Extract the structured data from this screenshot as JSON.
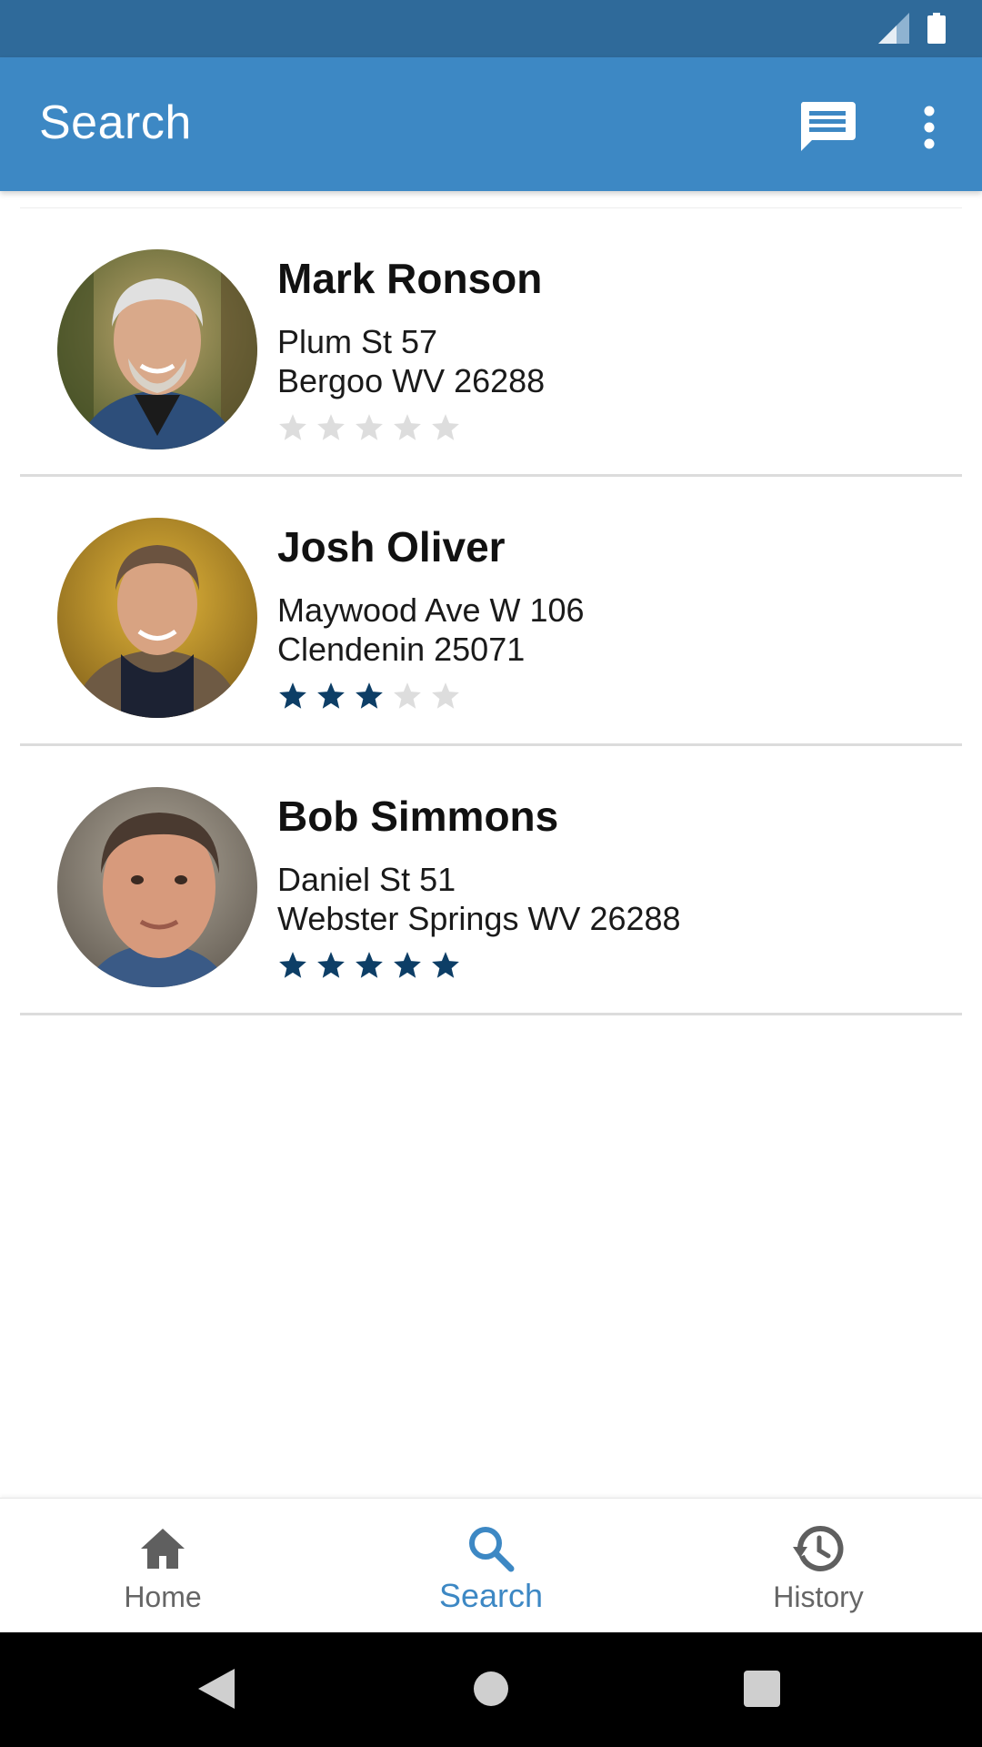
{
  "colors": {
    "status_bar": "#2f6a9a",
    "app_bar": "#3d88c4",
    "star_filled": "#0d3e66",
    "star_empty": "#dddddd",
    "nav_active": "#3d88c4",
    "nav_inactive": "#666666"
  },
  "app_bar": {
    "title": "Search",
    "chat_icon": "chat-icon",
    "more_icon": "more-vert-icon"
  },
  "results": [
    {
      "name": "Mark Ronson",
      "address_line1": "Plum St 57",
      "address_line2": "Bergoo WV 26288",
      "rating": 0,
      "rating_max": 5
    },
    {
      "name": "Josh Oliver",
      "address_line1": "Maywood Ave W 106",
      "address_line2": "Clendenin 25071",
      "rating": 3,
      "rating_max": 5
    },
    {
      "name": "Bob Simmons",
      "address_line1": "Daniel St 51",
      "address_line2": "Webster Springs WV 26288",
      "rating": 5,
      "rating_max": 5
    }
  ],
  "bottom_nav": {
    "items": [
      {
        "label": "Home",
        "icon": "home-icon",
        "active": false
      },
      {
        "label": "Search",
        "icon": "search-icon",
        "active": true
      },
      {
        "label": "History",
        "icon": "history-icon",
        "active": false
      }
    ]
  }
}
